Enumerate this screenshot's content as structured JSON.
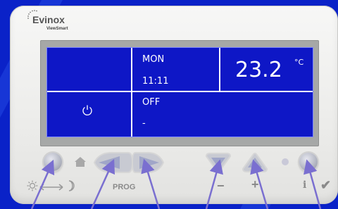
{
  "brand": {
    "name": "Evinox",
    "sub": "ViewSmart"
  },
  "display": {
    "day": "MON",
    "time": "11:11",
    "temperature": "23.2",
    "unit": "°C",
    "mode": "OFF",
    "mode_detail": "-"
  },
  "panel": {
    "prog_label": "PROG",
    "minus_label": "−",
    "plus_label": "+",
    "info_label": "i",
    "confirm_label": "✔"
  },
  "colors": {
    "lcd": "#0e17c6",
    "background": "#0a22c8",
    "panel": "#ececea",
    "button": "#b7bac6"
  },
  "icons": [
    "home-icon",
    "power-icon",
    "sun-icon",
    "moon-icon",
    "arrow-icon",
    "info-icon",
    "checkmark-icon",
    "indicator-led"
  ]
}
